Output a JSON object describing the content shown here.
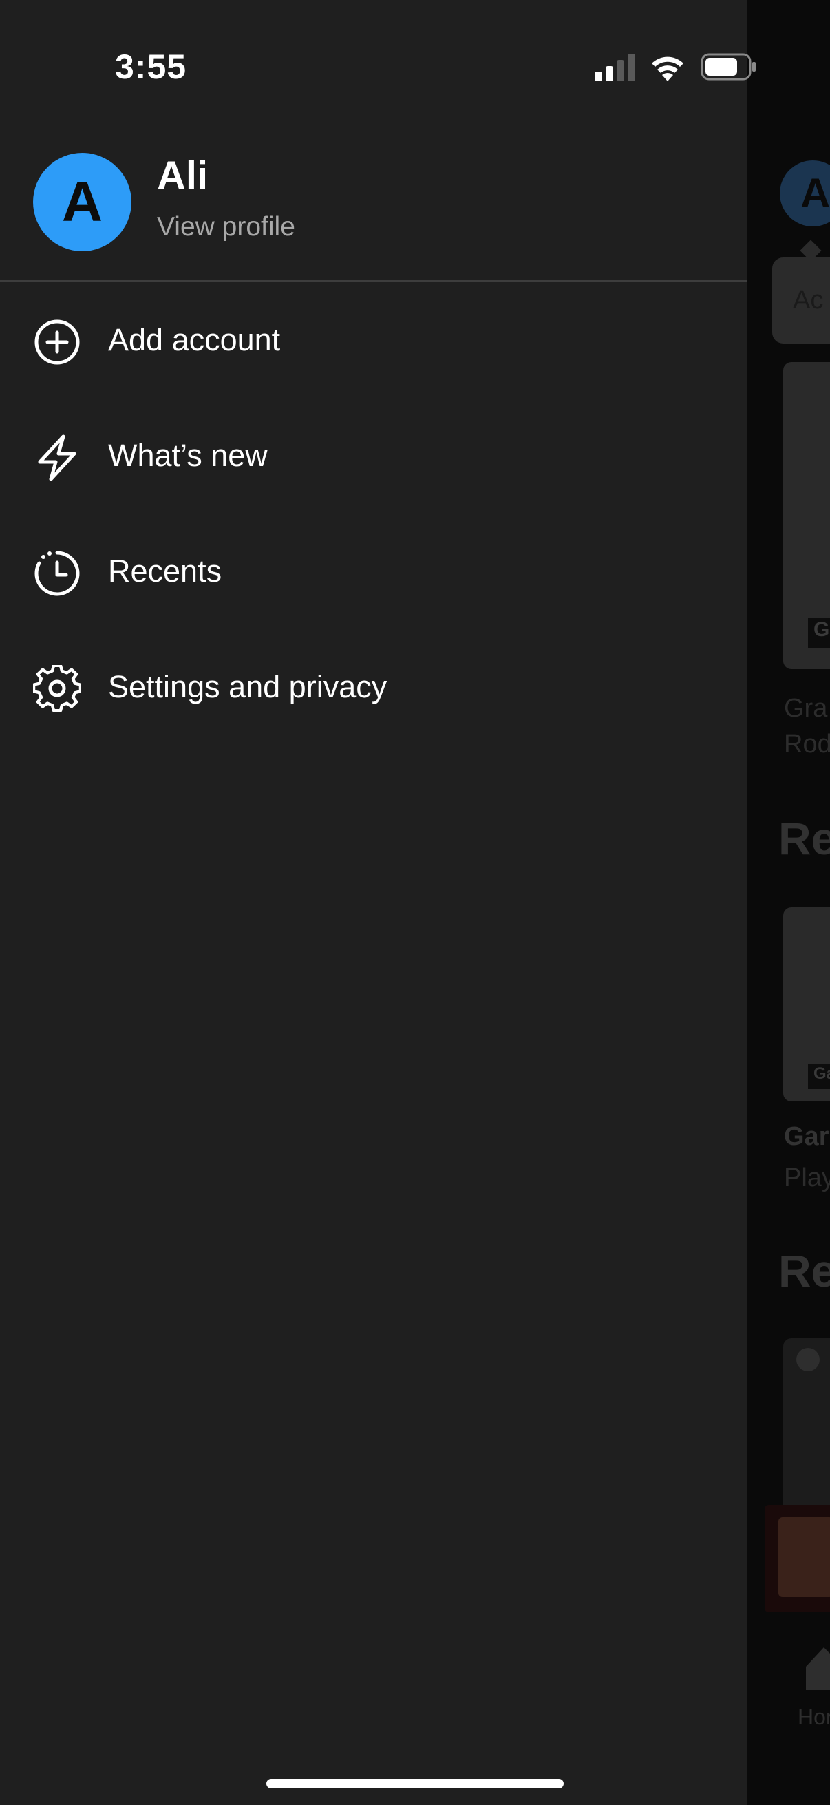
{
  "status_bar": {
    "time": "3:55"
  },
  "profile": {
    "avatar_letter": "A",
    "name": "Ali",
    "subtitle": "View profile"
  },
  "menu": {
    "items": [
      {
        "label": "Add account",
        "icon": "plus-circle-icon"
      },
      {
        "label": "What’s new",
        "icon": "lightning-icon"
      },
      {
        "label": "Recents",
        "icon": "recents-clock-icon"
      },
      {
        "label": "Settings and privacy",
        "icon": "gear-icon"
      }
    ]
  },
  "background": {
    "avatar_letter": "A",
    "tooltip_text": "Ac",
    "card1_tag": "G",
    "card1_lines": [
      "Gra",
      "Rod"
    ],
    "section1_heading": "Re",
    "card2_tag": "Ga",
    "card2_title": "Gar",
    "card2_subtitle": "Play",
    "section2_heading": "Re",
    "nav_home_label": "Hor"
  },
  "colors": {
    "drawer_bg": "#1f1f1f",
    "avatar_bg": "#2d9cf8",
    "secondary_text": "#a8a8a8"
  }
}
